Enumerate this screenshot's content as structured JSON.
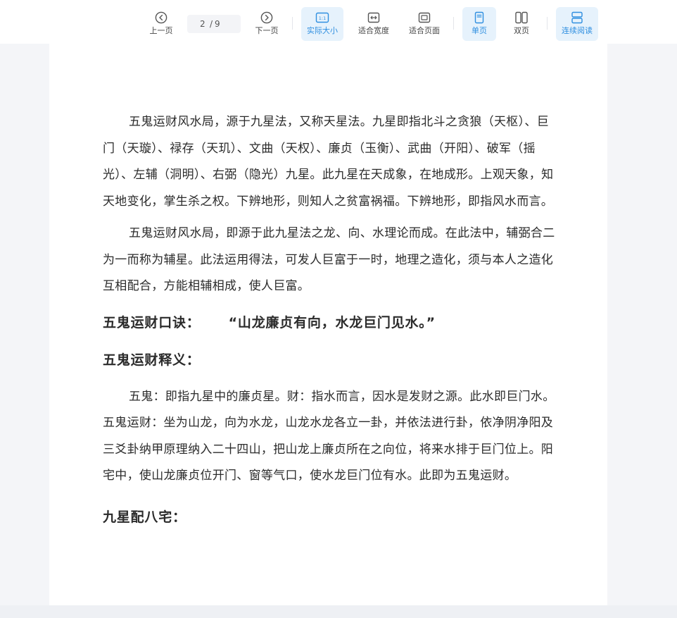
{
  "toolbar": {
    "prev_label": "上一页",
    "current_page": "2",
    "page_separator": "/",
    "total_pages": "9",
    "next_label": "下一页",
    "actual_size_label": "实际大小",
    "fit_width_label": "适合宽度",
    "fit_page_label": "适合页面",
    "single_page_label": "单页",
    "double_page_label": "双页",
    "continuous_label": "连续阅读",
    "actual_size_icon_text": "1:1",
    "accent_color": "#2f8fe0"
  },
  "document": {
    "paragraphs": [
      "五鬼运财风水局，源于九星法，又称天星法。九星即指北斗之贪狼（天枢）、巨门（天璇）、禄存（天玑）、文曲（天权）、廉贞（玉衡）、武曲（开阳）、破军（摇光）、左辅（洞明）、右弼（隐光）九星。此九星在天成象，在地成形。上观天象，知天地变化，掌生杀之权。下辨地形，则知人之贫富祸福。下辨地形，即指风水而言。",
      "五鬼运财风水局，即源于此九星法之龙、向、水理论而成。在此法中，辅弼合二为一而称为辅星。此法运用得法，可发人巨富于一时，地理之造化，须与本人之造化互相配合，方能相辅相成，使人巨富。"
    ],
    "heading_formula_label": "五鬼运财口诀：",
    "heading_formula_quote": "“山龙廉贞有向，水龙巨门见水。”",
    "heading_meaning": "五鬼运财释义：",
    "paragraph_meaning": "五鬼：即指九星中的廉贞星。财：指水而言，因水是发财之源。此水即巨门水。五鬼运财：坐为山龙，向为水龙，山龙水龙各立一卦，并依法进行卦，依净阴净阳及三爻卦纳甲原理纳入二十四山，把山龙上廉贞所在之向位，将来水排于巨门位上。阳宅中，使山龙廉贞位开门、窗等气口，使水龙巨门位有水。此即为五鬼运财。",
    "heading_eight_houses": "九星配八宅："
  }
}
